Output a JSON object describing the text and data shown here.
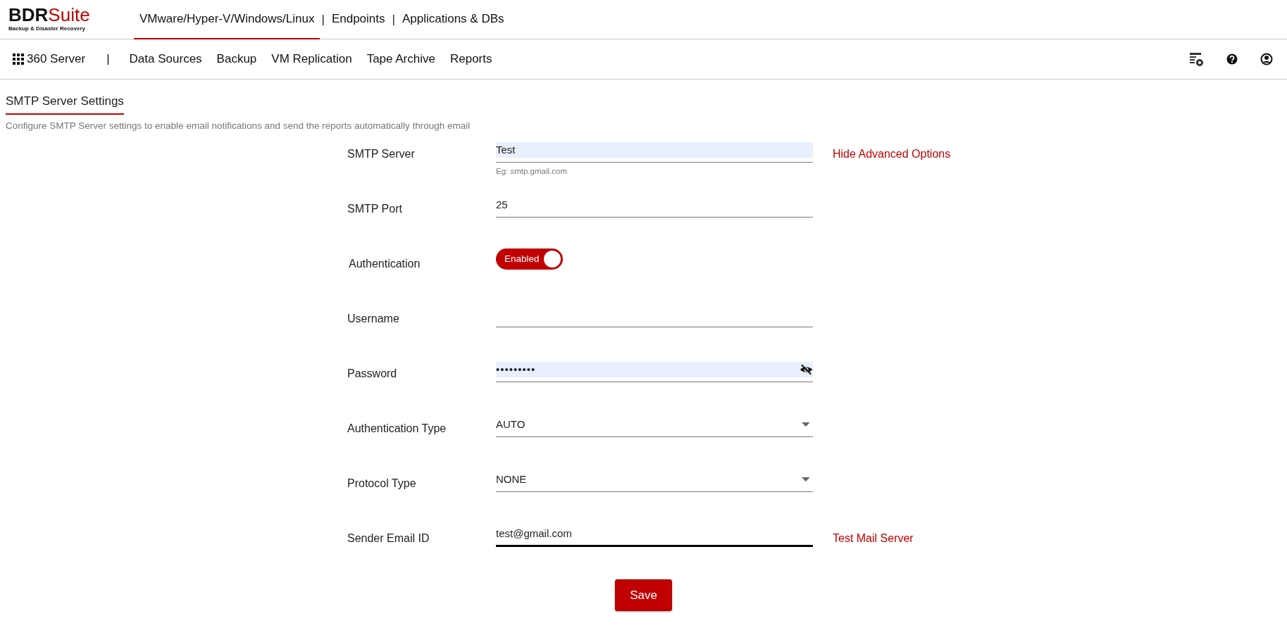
{
  "brand": {
    "main": "BDR",
    "accent": "Suite",
    "tagline": "Backup & Disaster Recovery"
  },
  "top_tabs": [
    {
      "kind": "tab",
      "label": "VMware/Hyper-V/Windows/Linux",
      "selected": true
    },
    {
      "kind": "separator",
      "label": "|"
    },
    {
      "kind": "tab",
      "label": "Endpoints",
      "selected": false
    },
    {
      "kind": "separator",
      "label": "|"
    },
    {
      "kind": "tab",
      "label": "Applications & DBs",
      "selected": false
    }
  ],
  "sub_nav": {
    "home": "360 Server",
    "separator": "|",
    "items": [
      "Data Sources",
      "Backup",
      "VM Replication",
      "Tape Archive",
      "Reports"
    ]
  },
  "page": {
    "title": "SMTP Server Settings",
    "description": "Configure SMTP Server settings to enable email notifications and send the reports automatically through email"
  },
  "form": [
    {
      "kind": "text",
      "label": "SMTP Server",
      "value": "Test",
      "hint": "Eg: smtp.gmail.com",
      "autofilled": true,
      "focused": false,
      "link": "Hide Advanced Options"
    },
    {
      "kind": "text",
      "label": "SMTP Port",
      "value": "25",
      "autofilled": false,
      "focused": false
    },
    {
      "kind": "toggle",
      "label": "Authentication",
      "on": true,
      "state_text": "Enabled"
    },
    {
      "kind": "text",
      "label": "Username",
      "autofilled": false,
      "focused": false
    },
    {
      "kind": "password",
      "label": "Password",
      "value": "•••••••••",
      "autofilled": true,
      "focused": false
    },
    {
      "kind": "select",
      "label": "Authentication Type",
      "value": "AUTO",
      "focused": false
    },
    {
      "kind": "select",
      "label": "Protocol Type",
      "value": "NONE",
      "focused": false
    },
    {
      "kind": "text",
      "label": "Sender Email ID",
      "value": "test@gmail.com",
      "autofilled": false,
      "focused": true,
      "link": "Test Mail Server"
    }
  ],
  "save_button": "Save"
}
